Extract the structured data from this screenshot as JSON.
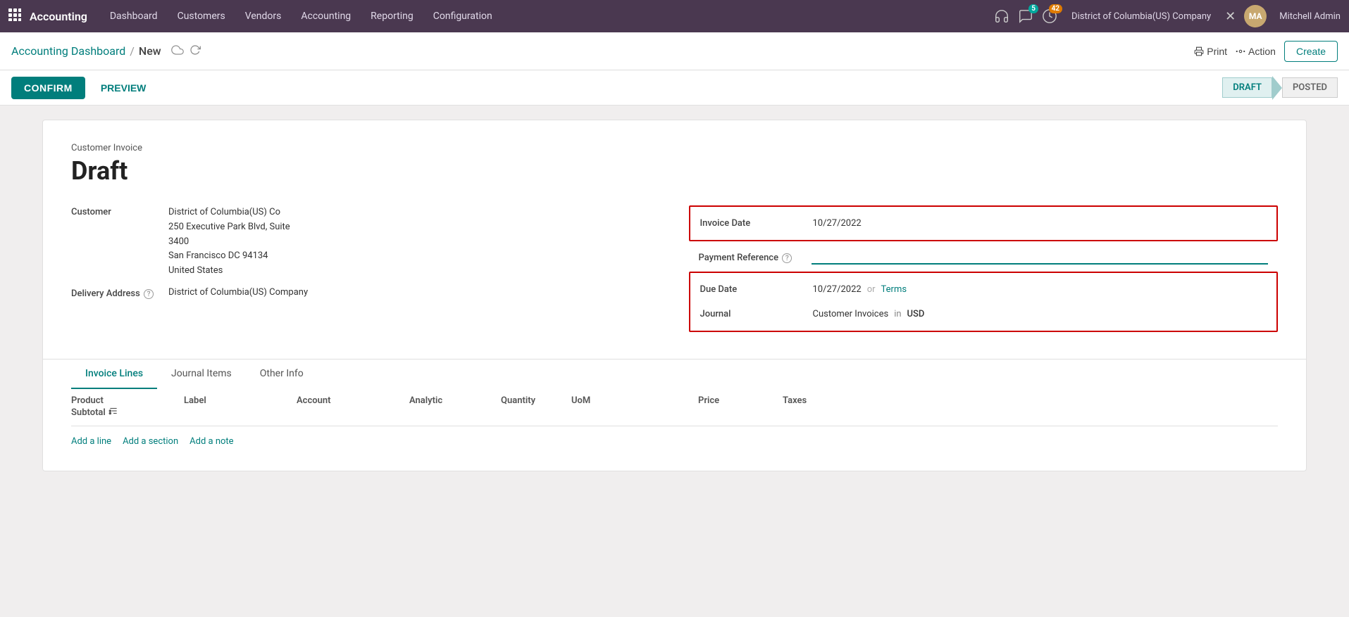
{
  "app": {
    "name": "Accounting",
    "nav_items": [
      "Dashboard",
      "Customers",
      "Vendors",
      "Accounting",
      "Reporting",
      "Configuration"
    ]
  },
  "topbar": {
    "chat_badge": "5",
    "activity_badge": "42",
    "company": "District of Columbia(US) Company",
    "user": "Mitchell Admin"
  },
  "breadcrumb": {
    "parent": "Accounting Dashboard",
    "separator": "/",
    "current": "New"
  },
  "toolbar": {
    "print_label": "Print",
    "action_label": "Action",
    "create_label": "Create"
  },
  "action_bar": {
    "confirm_label": "CONFIRM",
    "preview_label": "PREVIEW"
  },
  "status_steps": [
    {
      "id": "draft",
      "label": "DRAFT",
      "active": true
    },
    {
      "id": "posted",
      "label": "POSTED",
      "active": false
    }
  ],
  "invoice": {
    "type_label": "Customer Invoice",
    "status_title": "Draft",
    "customer_label": "Customer",
    "customer_name": "District of Columbia(US) Co",
    "customer_address_line1": "250 Executive Park Blvd, Suite",
    "customer_address_line2": "3400",
    "customer_address_line3": "San Francisco DC 94134",
    "customer_address_line4": "United States",
    "delivery_address_label": "Delivery Address",
    "delivery_address_value": "District of Columbia(US) Company",
    "invoice_date_label": "Invoice Date",
    "invoice_date_value": "10/27/2022",
    "payment_ref_label": "Payment Reference",
    "payment_ref_value": "",
    "due_date_label": "Due Date",
    "due_date_value": "10/27/2022",
    "due_or": "or",
    "due_terms": "Terms",
    "journal_label": "Journal",
    "journal_value": "Customer Invoices",
    "journal_in": "in",
    "journal_currency": "USD"
  },
  "tabs": [
    {
      "id": "invoice-lines",
      "label": "Invoice Lines",
      "active": true
    },
    {
      "id": "journal-items",
      "label": "Journal Items",
      "active": false
    },
    {
      "id": "other-info",
      "label": "Other Info",
      "active": false
    }
  ],
  "table": {
    "columns": [
      "Product",
      "Label",
      "Account",
      "Analytic",
      "Quantity",
      "UoM",
      "",
      "Price",
      "Taxes",
      "",
      "Subtotal"
    ],
    "add_line": "Add a line",
    "add_section": "Add a section",
    "add_note": "Add a note"
  }
}
